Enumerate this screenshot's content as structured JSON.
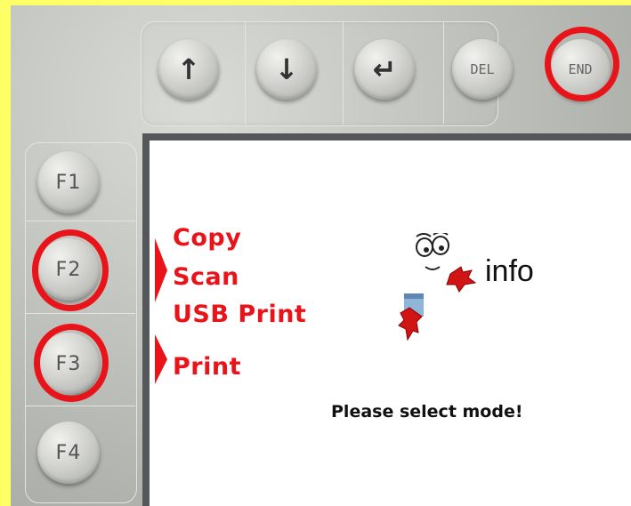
{
  "nav_keys": {
    "up": {
      "icon": "up-arrow-icon",
      "glyph": "↑"
    },
    "down": {
      "icon": "down-arrow-icon",
      "glyph": "↓"
    },
    "enter": {
      "icon": "enter-arrow-icon",
      "glyph": "↵"
    },
    "del_label": "DEL",
    "end_label": "END"
  },
  "function_keys": [
    "F1",
    "F2",
    "F3",
    "F4"
  ],
  "highlighted_keys": [
    "END",
    "F2",
    "F3"
  ],
  "screen": {
    "menu": {
      "f2_group": [
        "Copy",
        "Scan",
        "USB Print"
      ],
      "f3_group": [
        "Print"
      ]
    },
    "info_label": "info",
    "prompt": "Please select mode!"
  },
  "colors": {
    "background": "#ffff66",
    "highlight": "#e8141a",
    "panel": "#b9bcb6",
    "screen": "#ffffff"
  }
}
